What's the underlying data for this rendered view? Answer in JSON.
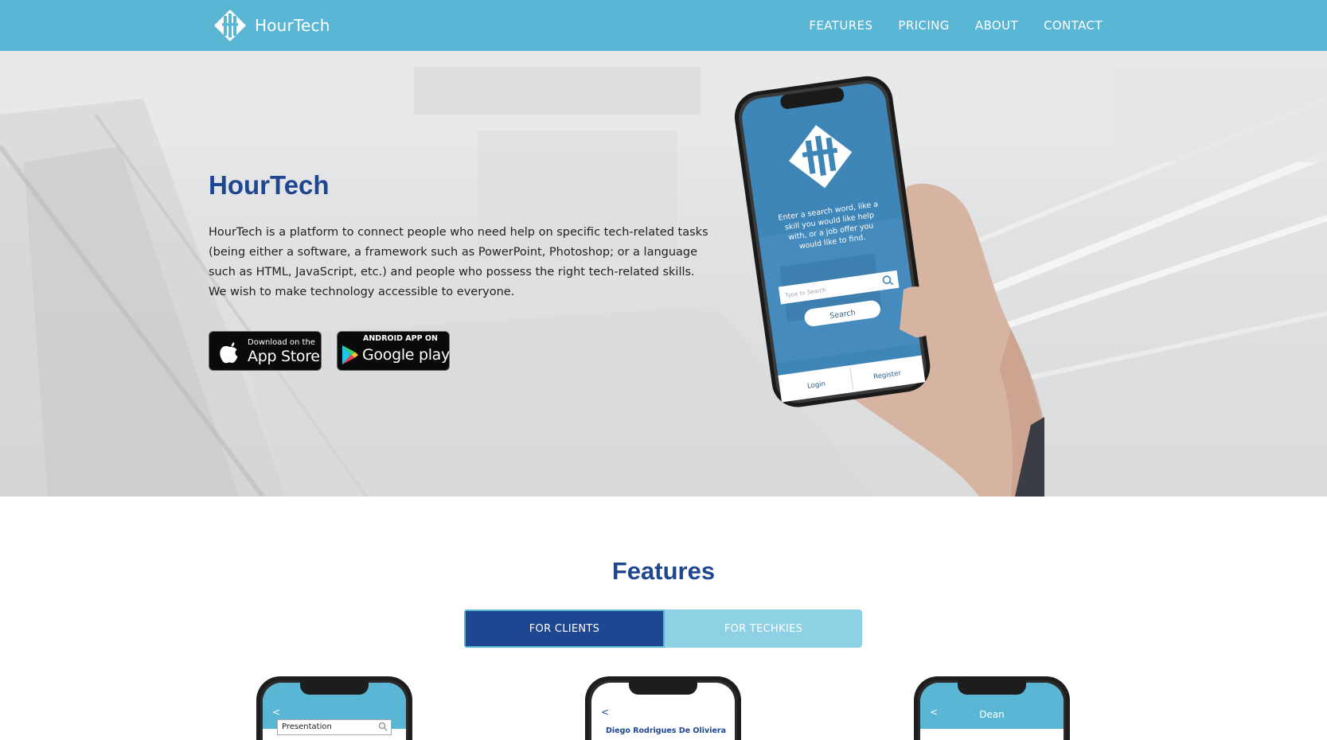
{
  "brand": {
    "name": "HourTech"
  },
  "nav": {
    "items": [
      "FEATURES",
      "PRICING",
      "ABOUT",
      "CONTACT"
    ]
  },
  "hero": {
    "title": "HourTech",
    "description": "HourTech is a platform to connect people who need help on specific tech-related tasks (being either a software, a framework such as PowerPoint, Photoshop; or a language such as HTML, JavaScript, etc.) and people who possess the right tech-related skills. We wish to make technology accessible to everyone.",
    "app_store": {
      "small": "Download on the",
      "big": "App Store"
    },
    "google_play": {
      "small": "ANDROID APP ON",
      "big": "Google play"
    },
    "phone": {
      "prompt_lines": [
        "Enter a search word, like a",
        "skill you would like help",
        "with, or a job offer you",
        "would like to find."
      ],
      "search_placeholder": "Type to Search",
      "search_button": "Search",
      "login": "Login",
      "register": "Register"
    }
  },
  "features": {
    "title": "Features",
    "tabs": [
      {
        "label": "FOR CLIENTS",
        "active": true
      },
      {
        "label": "FOR TECHKIES",
        "active": false
      }
    ],
    "previews": [
      {
        "search_text": "Presentation"
      },
      {
        "name": "Diego Rodrigues De Oliviera"
      },
      {
        "title": "Dean"
      }
    ]
  },
  "colors": {
    "navbar": "#59b6d4",
    "primary": "#1f4690",
    "tab_inactive": "#8ed1e4",
    "phone_screen": "#3f86b8"
  },
  "icons": [
    "hourtech-logo-icon",
    "apple-icon",
    "google-play-icon",
    "search-icon",
    "chevron-left-icon"
  ]
}
